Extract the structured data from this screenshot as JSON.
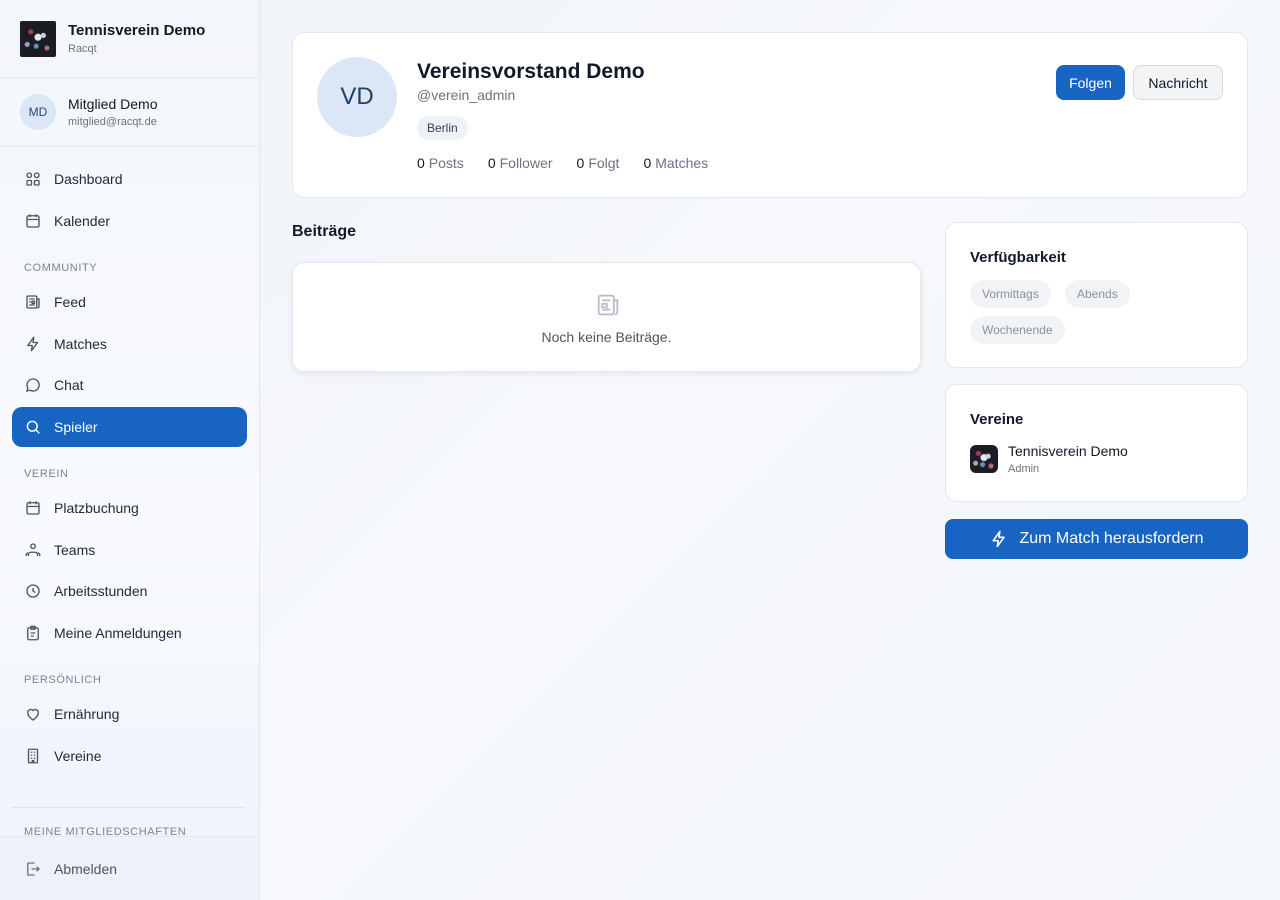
{
  "brand": {
    "name": "Tennisverein Demo",
    "subtitle": "Racqt"
  },
  "user": {
    "initials": "MD",
    "name": "Mitglied Demo",
    "email": "mitglied@racqt.de"
  },
  "nav": {
    "main": [
      {
        "label": "Dashboard",
        "icon": "dashboard-icon"
      },
      {
        "label": "Kalender",
        "icon": "calendar-icon"
      }
    ],
    "sections": [
      {
        "title": "COMMUNITY",
        "items": [
          {
            "label": "Feed",
            "icon": "newspaper-icon"
          },
          {
            "label": "Matches",
            "icon": "lightning-icon"
          },
          {
            "label": "Chat",
            "icon": "chat-icon"
          },
          {
            "label": "Spieler",
            "icon": "search-icon",
            "active": true
          }
        ]
      },
      {
        "title": "VEREIN",
        "items": [
          {
            "label": "Platzbuchung",
            "icon": "calendar-icon"
          },
          {
            "label": "Teams",
            "icon": "teams-icon"
          },
          {
            "label": "Arbeitsstunden",
            "icon": "clock-icon"
          },
          {
            "label": "Meine Anmeldungen",
            "icon": "clipboard-icon"
          }
        ]
      },
      {
        "title": "PERSÖNLICH",
        "items": [
          {
            "label": "Ernährung",
            "icon": "heart-icon"
          },
          {
            "label": "Vereine",
            "icon": "building-icon"
          }
        ]
      }
    ],
    "memberships_title": "MEINE MITGLIEDSCHAFTEN",
    "logout": "Abmelden"
  },
  "profile": {
    "initials": "VD",
    "name": "Vereinsvorstand Demo",
    "handle": "@verein_admin",
    "city": "Berlin",
    "stats": [
      {
        "value": "0",
        "label": "Posts"
      },
      {
        "value": "0",
        "label": "Follower"
      },
      {
        "value": "0",
        "label": "Folgt"
      },
      {
        "value": "0",
        "label": "Matches"
      }
    ],
    "follow_label": "Folgen",
    "message_label": "Nachricht"
  },
  "posts": {
    "title": "Beiträge",
    "empty_text": "Noch keine Beiträge."
  },
  "availability": {
    "title": "Verfügbarkeit",
    "slots": [
      "Vormittags",
      "Abends",
      "Wochenende"
    ]
  },
  "clubs": {
    "title": "Vereine",
    "items": [
      {
        "name": "Tennisverein Demo",
        "role": "Admin"
      }
    ]
  },
  "challenge_label": "Zum Match herausfordern",
  "colors": {
    "accent": "#1764c3",
    "avatar_bg": "#dbe7f7"
  }
}
